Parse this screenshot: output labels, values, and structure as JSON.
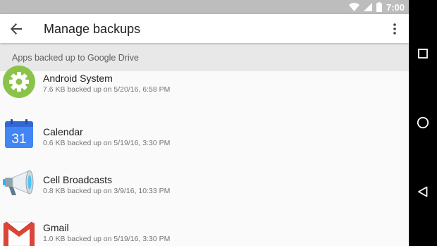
{
  "status_bar": {
    "time": "7:00",
    "icons": [
      "wifi-icon",
      "cell-signal-icon",
      "battery-icon"
    ]
  },
  "app_bar": {
    "back_icon": "arrow-back-icon",
    "title": "Manage backups",
    "overflow_icon": "more-vert-icon"
  },
  "section": {
    "header": "Apps backed up to Google Drive"
  },
  "apps": [
    {
      "name": "Android System",
      "detail": "7.6 KB backed up on 5/20/16, 6:58 PM",
      "icon": "android-system-gear-icon"
    },
    {
      "name": "Calendar",
      "detail": "0.6 KB backed up on 5/19/16, 3:30 PM",
      "icon": "calendar-icon",
      "icon_text": "31"
    },
    {
      "name": "Cell Broadcasts",
      "detail": "0.8 KB backed up on 3/9/16, 10:33 PM",
      "icon": "megaphone-icon"
    },
    {
      "name": "Gmail",
      "detail": "1.0 KB backed up on 5/19/16, 3:30 PM",
      "icon": "gmail-icon"
    }
  ],
  "nav_bar": {
    "buttons": [
      "recents-square-icon",
      "home-circle-icon",
      "back-triangle-icon"
    ]
  },
  "colors": {
    "status_bar": "#bdbdbd",
    "section_bg": "#e8e8e8",
    "android_green": "#8bc34a",
    "calendar_blue": "#4285f4",
    "gmail_red": "#db4437"
  }
}
